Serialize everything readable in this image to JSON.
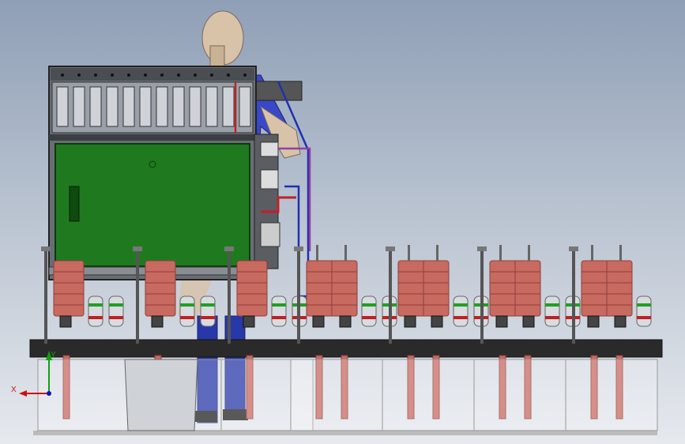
{
  "view": {
    "axes": {
      "x_label": "X",
      "y_label": "Y"
    }
  },
  "colors": {
    "background_top": "#8f9fb6",
    "panel_green": "#1f7a1f",
    "drum": "#c86a60",
    "drum_dark": "#8e3f3a",
    "frame": "#3a3a3a",
    "bowl": "#d8dadf",
    "hose_red": "#c0202a",
    "hose_blue": "#2030b0",
    "hose_purple": "#9040a0",
    "person_shirt": "#3848c8",
    "person_skin": "#d8c2a8",
    "axis_x": "#d01010",
    "axis_y": "#10a010",
    "axis_z": "#1010d0"
  },
  "stations": [
    {
      "id": "station-1",
      "drums": 1
    },
    {
      "id": "station-2",
      "drums": 1
    },
    {
      "id": "station-3",
      "drums": 1
    },
    {
      "id": "station-4",
      "drums": 2
    },
    {
      "id": "station-5",
      "drums": 2
    },
    {
      "id": "station-6",
      "drums": 2
    },
    {
      "id": "station-7",
      "drums": 2
    }
  ]
}
